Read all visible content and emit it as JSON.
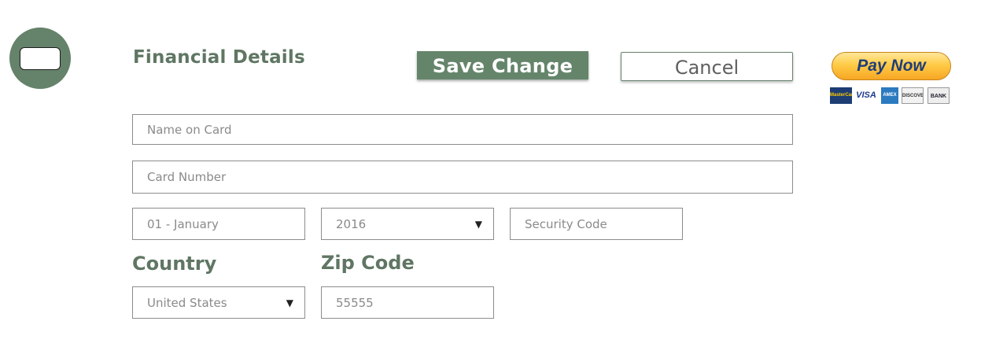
{
  "header": {
    "title": "Financial Details",
    "save_label": "Save Change",
    "cancel_label": "Cancel",
    "paynow_label": "Pay Now"
  },
  "payment_logos": {
    "mastercard": "MasterCard",
    "visa": "VISA",
    "amex": "AMEX",
    "discover": "DISCOVER",
    "bank": "BANK"
  },
  "form": {
    "name_on_card": {
      "placeholder": "Name on Card",
      "value": ""
    },
    "card_number": {
      "placeholder": "Card Number",
      "value": ""
    },
    "exp_month": {
      "value": "01 - January"
    },
    "exp_year": {
      "value": "2016",
      "arrow": "▼"
    },
    "security_code": {
      "placeholder": "Security Code",
      "value": ""
    },
    "country_label": "Country",
    "country": {
      "value": "United States",
      "arrow": "▼"
    },
    "zip_label": "Zip Code",
    "zip": {
      "value": "55555"
    }
  },
  "colors": {
    "accent": "#65856b",
    "title": "#5f7663",
    "field_border": "#8c8c8c",
    "placeholder_text": "#8a8a8a"
  },
  "icons": {
    "avatar": "credit-card-icon"
  }
}
